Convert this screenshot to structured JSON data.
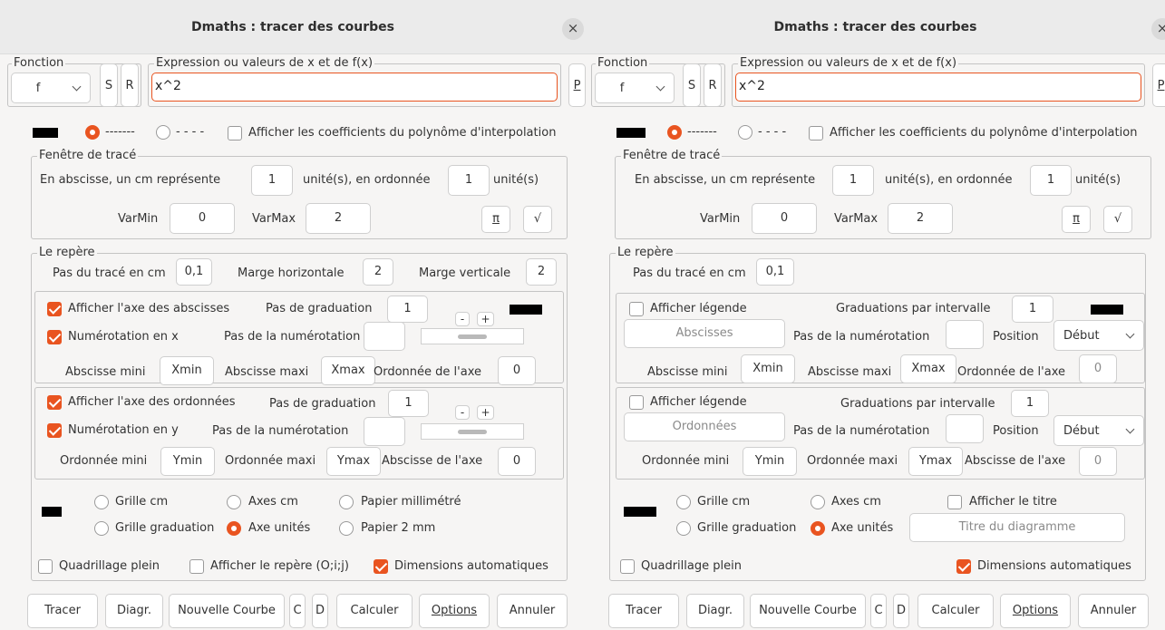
{
  "title": "Dmaths : tracer des courbes",
  "icons": {
    "close": "close-icon",
    "dropdown": "chevron-down-icon",
    "color_swatch": "color-swatch"
  },
  "colors": {
    "accent": "#e95420",
    "swatch": "#000000"
  },
  "shared": {
    "fonction_legend": "Fonction",
    "fonction_value": "f",
    "s_label": "S",
    "r_label": "R",
    "p_label": "P",
    "expression_legend": "Expression ou valeurs de x et de f(x)",
    "expression_value": "x^2",
    "solid_line_label": "-------",
    "dashed_line_label": "- - - -",
    "show_coeffs_label": "Afficher les coefficients du polynôme d'interpolation",
    "window_legend": "Fenêtre de tracé",
    "abscissa_cm_label": "En abscisse, un cm représente",
    "abscissa_unit_value": "1",
    "ordinate_label": "unité(s), en ordonnée",
    "ordinate_unit_value": "1",
    "units_label": "unité(s)",
    "varmin_label": "VarMin",
    "varmin_value": "0",
    "varmax_label": "VarMax",
    "varmax_value": "2",
    "pi_button": "π",
    "sqrt_button": "√",
    "repere_legend": "Le repère",
    "step_label": "Pas du tracé en cm",
    "step_value": "0,1"
  },
  "left": {
    "margin_h_label": "Marge horizontale",
    "margin_h_value": "2",
    "margin_v_label": "Marge verticale",
    "margin_v_value": "2",
    "x_axis": {
      "show_label": "Afficher l'axe des abscisses",
      "grad_label": "Pas de graduation",
      "grad_value": "1",
      "minus": "-",
      "plus": "+",
      "numbering_label": "Numérotation en x",
      "num_step_label": "Pas de la numérotation",
      "num_step_value": "",
      "min_label": "Abscisse mini",
      "min_value": "Xmin",
      "max_label": "Abscisse maxi",
      "max_value": "Xmax",
      "axis_pos_label": "Ordonnée de l'axe",
      "axis_pos_value": "0"
    },
    "y_axis": {
      "show_label": "Afficher l'axe des ordonnées",
      "grad_label": "Pas de graduation",
      "grad_value": "1",
      "minus": "-",
      "plus": "+",
      "numbering_label": "Numérotation en y",
      "num_step_label": "Pas de la numérotation",
      "num_step_value": "",
      "min_label": "Ordonnée mini",
      "min_value": "Ymin",
      "max_label": "Ordonnée maxi",
      "max_value": "Ymax",
      "axis_pos_label": "Abscisse de l'axe",
      "axis_pos_value": "0"
    },
    "grid_cm": "Grille cm",
    "axes_cm": "Axes cm",
    "papier_mm": "Papier millimétré",
    "grid_grad": "Grille graduation",
    "axe_unites": "Axe unités",
    "papier_2mm": "Papier 2 mm",
    "quadrillage": "Quadrillage plein",
    "show_repere": "Afficher le repère (O;i;j)",
    "dims_auto": "Dimensions automatiques"
  },
  "right": {
    "x_axis": {
      "legend_label": "Afficher légende",
      "grad_label": "Graduations par intervalle",
      "grad_value": "1",
      "legend_value": "Abscisses",
      "num_step_label": "Pas de la numérotation",
      "num_step_value": "",
      "position_label": "Position",
      "position_value": "Début",
      "min_label": "Abscisse mini",
      "min_value": "Xmin",
      "max_label": "Abscisse maxi",
      "max_value": "Xmax",
      "axis_pos_label": "Ordonnée de l'axe",
      "axis_pos_value": "0"
    },
    "y_axis": {
      "legend_label": "Afficher légende",
      "grad_label": "Graduations par intervalle",
      "grad_value": "1",
      "legend_value": "Ordonnées",
      "num_step_label": "Pas de la numérotation",
      "num_step_value": "",
      "position_label": "Position",
      "position_value": "Début",
      "min_label": "Ordonnée mini",
      "min_value": "Ymin",
      "max_label": "Ordonnée maxi",
      "max_value": "Ymax",
      "axis_pos_label": "Abscisse de l'axe",
      "axis_pos_value": "0"
    },
    "grid_cm": "Grille cm",
    "axes_cm": "Axes cm",
    "show_title": "Afficher le titre",
    "grid_grad": "Grille graduation",
    "axe_unites": "Axe unités",
    "title_placeholder": "Titre du diagramme",
    "quadrillage": "Quadrillage plein",
    "dims_auto": "Dimensions automatiques"
  },
  "footer": {
    "tracer": "Tracer",
    "diagr": "Diagr.",
    "nouvelle": "Nouvelle Courbe",
    "c": "C",
    "d": "D",
    "calculer": "Calculer",
    "options": "Options",
    "annuler": "Annuler"
  }
}
